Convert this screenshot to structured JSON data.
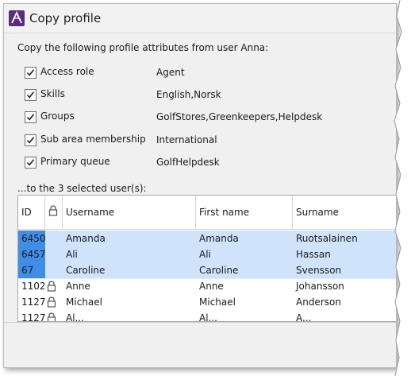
{
  "window": {
    "title": "Copy profile",
    "icon": "app-logo-icon"
  },
  "intro": "Copy the following profile attributes from user Anna:",
  "attributes": [
    {
      "label": "Access role",
      "value": "Agent",
      "checked": true
    },
    {
      "label": "Skills",
      "value": "English,Norsk",
      "checked": true
    },
    {
      "label": "Groups",
      "value": "GolfStores,Greenkeepers,Helpdesk",
      "checked": true
    },
    {
      "label": "Sub area membership",
      "value": "International",
      "checked": true
    },
    {
      "label": "Primary queue",
      "value": "GolfHelpdesk",
      "checked": true
    }
  ],
  "subheading": "...to the 3 selected user(s):",
  "table": {
    "columns": {
      "id": "ID",
      "lock": "lock-icon",
      "username": "Username",
      "firstname": "First name",
      "surname": "Surname"
    },
    "rows": [
      {
        "id": "6450",
        "locked": false,
        "username": "Amanda",
        "firstname": "Amanda",
        "surname": "Ruotsalainen",
        "selected": true
      },
      {
        "id": "6457",
        "locked": false,
        "username": "Ali",
        "firstname": "Ali",
        "surname": "Hassan",
        "selected": true
      },
      {
        "id": "67",
        "locked": false,
        "username": "Caroline",
        "firstname": "Caroline",
        "surname": "Svensson",
        "selected": true
      },
      {
        "id": "1102",
        "locked": true,
        "username": "Anne",
        "firstname": "Anne",
        "surname": "Johansson",
        "selected": false
      },
      {
        "id": "1127",
        "locked": true,
        "username": "Michael",
        "firstname": "Michael",
        "surname": "Anderson",
        "selected": false
      },
      {
        "id": "1127",
        "locked": true,
        "username": "Al...",
        "firstname": "Al...",
        "surname": "A...",
        "selected": false
      }
    ]
  },
  "colors": {
    "selected_id": "#3f8de6",
    "selected_row": "#cfe3fb",
    "titlebar": "#f2f2f2",
    "accent": "#5b2d82"
  }
}
